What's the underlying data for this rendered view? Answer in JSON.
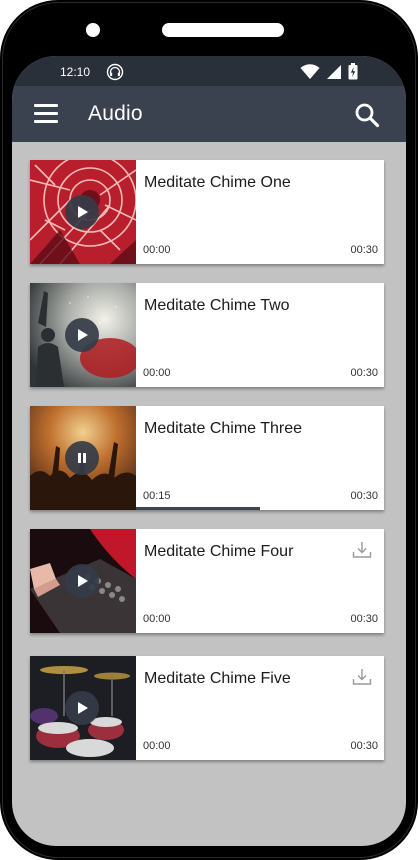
{
  "status_bar": {
    "time": "12:10",
    "icons": [
      "headphones-icon",
      "wifi-icon",
      "signal-icon",
      "battery-charging-icon"
    ]
  },
  "app_bar": {
    "title": "Audio",
    "menu_icon": "hamburger-menu-icon",
    "search_icon": "search-icon"
  },
  "colors": {
    "status_bar": "#2a3039",
    "app_bar": "#39424e",
    "screen_background": "#c2c2c2",
    "control_dark": "#343c48"
  },
  "tracks": [
    {
      "title": "Meditate Chime One",
      "elapsed": "00:00",
      "duration": "00:30",
      "state": "paused",
      "control_icon": "play-icon",
      "progress": 0,
      "downloadable": false
    },
    {
      "title": "Meditate Chime Two",
      "elapsed": "00:00",
      "duration": "00:30",
      "state": "paused",
      "control_icon": "play-icon",
      "progress": 0,
      "downloadable": false
    },
    {
      "title": "Meditate Chime Three",
      "elapsed": "00:15",
      "duration": "00:30",
      "state": "playing",
      "control_icon": "pause-icon",
      "progress": 0.5,
      "downloadable": false
    },
    {
      "title": "Meditate Chime Four",
      "elapsed": "00:00",
      "duration": "00:30",
      "state": "paused",
      "control_icon": "play-icon",
      "progress": 0,
      "downloadable": true
    },
    {
      "title": "Meditate Chime Five",
      "elapsed": "00:00",
      "duration": "00:30",
      "state": "paused",
      "control_icon": "play-icon",
      "progress": 0,
      "downloadable": true
    }
  ]
}
